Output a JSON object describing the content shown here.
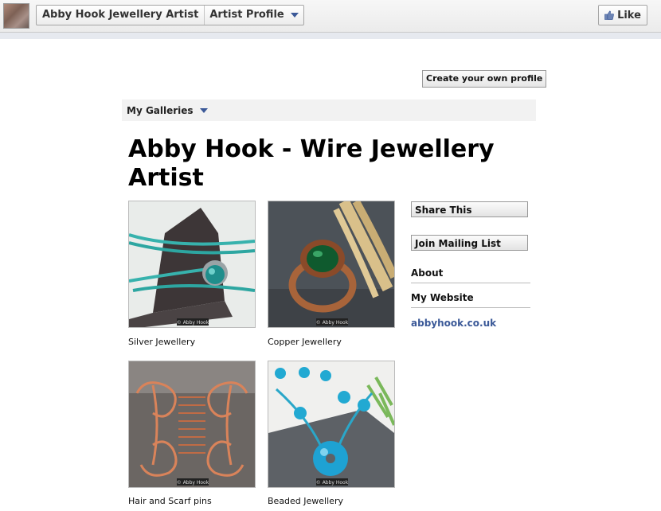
{
  "topbar": {
    "page_name": "Abby Hook Jewellery Artist",
    "app_name": "Artist Profile",
    "like_label": "Like"
  },
  "main": {
    "create_profile_label": "Create your own profile",
    "galleries_label": "My Galleries",
    "title": "Abby Hook - Wire Jewellery Artist",
    "galleries": [
      {
        "caption": "Silver Jewellery",
        "watermark": "© Abby Hook"
      },
      {
        "caption": "Copper Jewellery",
        "watermark": "© Abby Hook"
      },
      {
        "caption": "Hair and Scarf pins",
        "watermark": "© Abby Hook"
      },
      {
        "caption": "Beaded Jewellery",
        "watermark": "© Abby Hook"
      }
    ]
  },
  "sidebar": {
    "share_label": "Share This",
    "mailing_label": "Join Mailing List",
    "about_label": "About",
    "website_label": "My Website",
    "website_url": "abbyhook.co.uk"
  },
  "colors": {
    "link": "#3b5998",
    "bar": "#f2f2f2"
  }
}
